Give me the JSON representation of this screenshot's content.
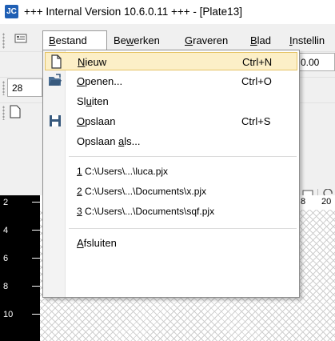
{
  "window": {
    "title": "+++ Internal Version 10.6.0.11 +++ - [Plate13]",
    "logo_icon": "app-logo-icon"
  },
  "menubar": {
    "tabs": [
      {
        "pre": "",
        "key": "B",
        "post": "estand"
      },
      {
        "pre": "Be",
        "key": "w",
        "post": "erken"
      },
      {
        "pre": "",
        "key": "G",
        "post": "raveren"
      },
      {
        "pre": "",
        "key": "B",
        "post": "lad"
      },
      {
        "pre": "",
        "key": "I",
        "post": "nstellin"
      }
    ]
  },
  "toolbar": {
    "value_field": "0.00",
    "size_field": "28",
    "ruler_labels": [
      "8",
      "20"
    ]
  },
  "ruler_left": [
    "2",
    "4",
    "6",
    "8",
    "10"
  ],
  "dropdown": {
    "items": [
      {
        "icon": "new-document-icon",
        "pre": "",
        "key": "N",
        "post": "ieuw",
        "shortcut": "Ctrl+N",
        "highlighted": true
      },
      {
        "icon": "open-folder-icon",
        "pre": "",
        "key": "O",
        "post": "penen...",
        "shortcut": "Ctrl+O"
      },
      {
        "icon": "",
        "pre": "Sl",
        "key": "u",
        "post": "iten",
        "shortcut": ""
      },
      {
        "icon": "save-disk-icon",
        "pre": "",
        "key": "O",
        "post": "pslaan",
        "shortcut": "Ctrl+S"
      },
      {
        "icon": "",
        "pre": "Opslaan ",
        "key": "a",
        "post": "ls...",
        "shortcut": ""
      },
      {
        "icon": "",
        "pre": "",
        "key": "1",
        "post": " C:\\Users\\...\\luca.pjx",
        "shortcut": ""
      },
      {
        "icon": "",
        "pre": "",
        "key": "2",
        "post": " C:\\Users\\...\\Documents\\x.pjx",
        "shortcut": ""
      },
      {
        "icon": "",
        "pre": "",
        "key": "3",
        "post": " C:\\Users\\...\\Documents\\sqf.pjx",
        "shortcut": ""
      },
      {
        "icon": "",
        "pre": "",
        "key": "A",
        "post": "fsluiten",
        "shortcut": ""
      }
    ]
  }
}
